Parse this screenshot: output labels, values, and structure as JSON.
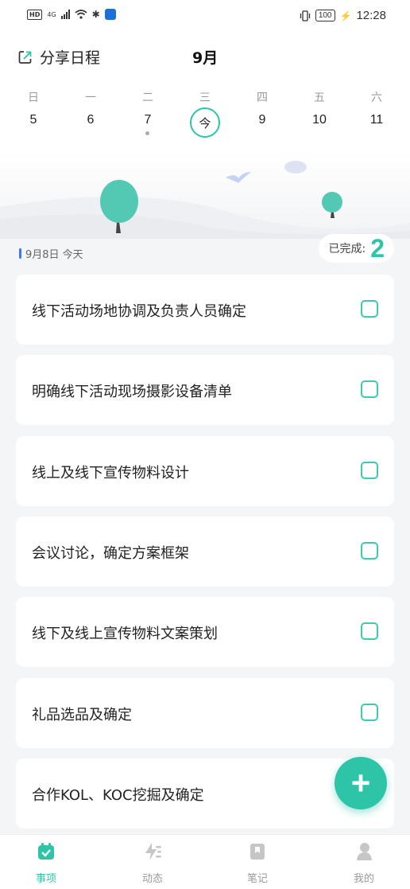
{
  "status_bar": {
    "network": "4G",
    "battery": "100",
    "time": "12:28"
  },
  "header": {
    "share_label": "分享日程",
    "month": "9月"
  },
  "week": {
    "days": [
      "日",
      "一",
      "二",
      "三",
      "四",
      "五",
      "六"
    ],
    "dates": [
      "5",
      "6",
      "7",
      "今",
      "9",
      "10",
      "11"
    ]
  },
  "summary": {
    "date": "9月8日 今天",
    "completed_label": "已完成:",
    "completed_count": "2"
  },
  "tasks": [
    "线下活动场地协调及负责人员确定",
    "明确线下活动现场摄影设备清单",
    "线上及线下宣传物料设计",
    "会议讨论，确定方案框架",
    "线下及线上宣传物料文案策划",
    "礼品选品及确定",
    "合作KOL、KOC挖掘及确定"
  ],
  "nav": {
    "items": [
      "事项",
      "动态",
      "笔记",
      "我的"
    ],
    "active_color": "#2ec4a8"
  },
  "colors": {
    "accent": "#2ec4a8",
    "date_mark": "#3a7bf0"
  }
}
